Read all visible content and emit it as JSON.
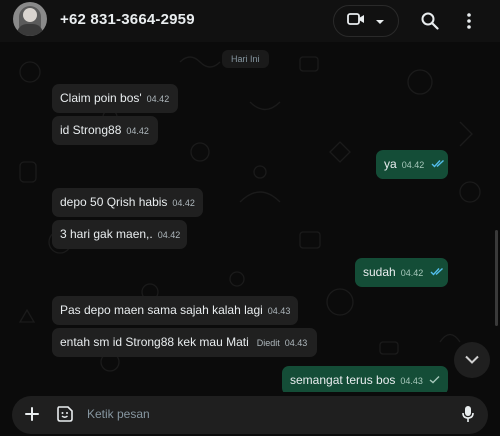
{
  "header": {
    "contact_name": "+62 831-3664-2959",
    "icons": [
      "avatar",
      "video-call-icon",
      "chevron-down-icon",
      "search-icon",
      "more-vert-icon"
    ]
  },
  "chat": {
    "date_label": "Hari Ini",
    "messages": [
      {
        "direction": "in",
        "text": "Claim poin bos'",
        "time": "04.42",
        "edited": "",
        "status": ""
      },
      {
        "direction": "in",
        "text": "id Strong88",
        "time": "04.42",
        "edited": "",
        "status": ""
      },
      {
        "direction": "out",
        "text": "ya",
        "time": "04.42",
        "edited": "",
        "status": "read"
      },
      {
        "direction": "in",
        "text": "depo 50 Qrish habis",
        "time": "04.42",
        "edited": "",
        "status": ""
      },
      {
        "direction": "in",
        "text": "3 hari gak maen,.",
        "time": "04.42",
        "edited": "",
        "status": ""
      },
      {
        "direction": "out",
        "text": "sudah",
        "time": "04.42",
        "edited": "",
        "status": "read"
      },
      {
        "direction": "in",
        "text": "Pas depo maen sama sajah kalah lagi",
        "time": "04.43",
        "edited": "",
        "status": ""
      },
      {
        "direction": "in",
        "text": "entah sm id Strong88 kek mau Mati",
        "time": "04.43",
        "edited": "Diedit",
        "status": ""
      },
      {
        "direction": "out",
        "text": "semangat terus bos",
        "time": "04.43",
        "edited": "",
        "status": "sent"
      }
    ]
  },
  "composer": {
    "placeholder": "Ketik pesan"
  },
  "colors": {
    "background": "#0b0b0b",
    "header": "#111111",
    "bubble_in": "#202020",
    "bubble_out": "#144d37",
    "read_tick": "#53bdeb"
  }
}
